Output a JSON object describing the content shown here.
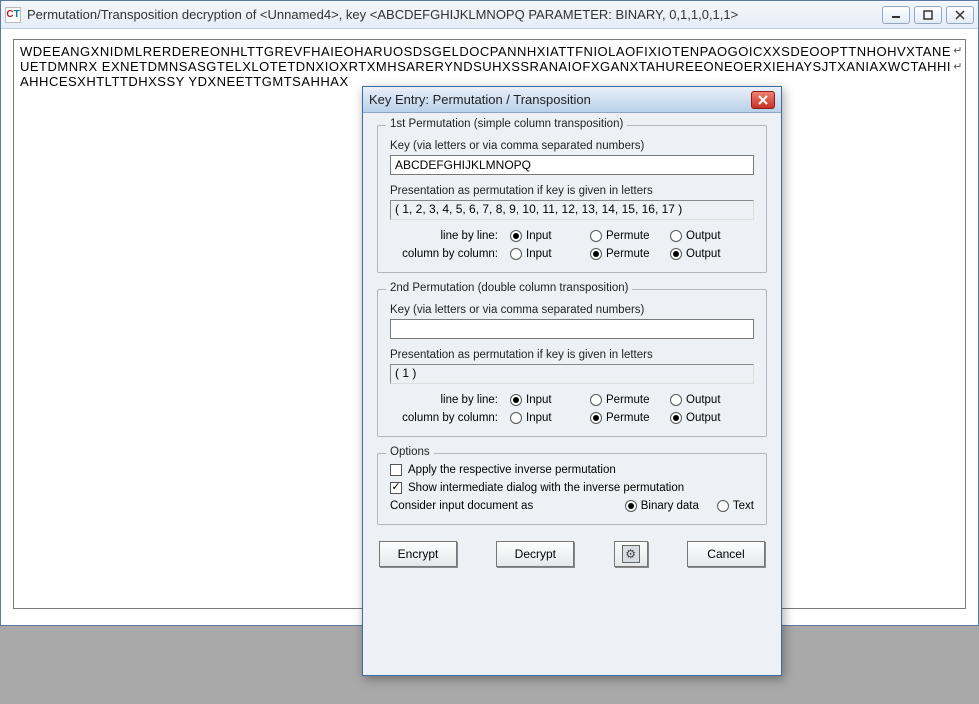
{
  "window": {
    "title": "Permutation/Transposition decryption of <Unnamed4>, key <ABCDEFGHIJKLMNOPQ PARAMETER: BINARY, 0,1,1,0,1,1>",
    "ciphertext": "WDEEANGXNIDMLRERDEREONHLTTGREVFHAIEOHARUOSDSGELDOCPANNHXIATTFNIOLAOFIXIOTENPAOGOICXXSDEOOPTTNHOHVXTANEUETDMNRX EXNETDMNSASGTELXLOTETDNXIOXRTXMHSARERYNDSUHXSSRANAIOFXGANXTAHUREEONEOERXIEHAYSJTXANIAXWCTAHHIAHHCESXHTLTTDHXSSY YDXNEETTGMTSAHHAX"
  },
  "dialog": {
    "title": "Key Entry: Permutation / Transposition",
    "perm1": {
      "group": "1st Permutation (simple column transposition)",
      "key_label": "Key (via letters or via comma separated numbers)",
      "key_value": "ABCDEFGHIJKLMNOPQ",
      "pres_label": "Presentation as permutation if key is given in letters",
      "pres_value": "( 1, 2, 3, 4, 5, 6, 7, 8, 9, 10, 11, 12, 13, 14, 15, 16, 17 )",
      "radio": {
        "row1": "line by line:",
        "row2": "column by column:",
        "c1": "Input",
        "c2": "Permute",
        "c3": "Output"
      }
    },
    "perm2": {
      "group": "2nd Permutation (double column transposition)",
      "key_label": "Key (via letters or via comma separated numbers)",
      "key_value": "",
      "pres_label": "Presentation as permutation if key is given in letters",
      "pres_value": "( 1 )",
      "radio": {
        "row1": "line by line:",
        "row2": "column by column:",
        "c1": "Input",
        "c2": "Permute",
        "c3": "Output"
      }
    },
    "options": {
      "group": "Options",
      "opt1": "Apply the respective inverse permutation",
      "opt2": "Show intermediate dialog with the inverse permutation",
      "consider": "Consider input document as",
      "binary": "Binary data",
      "text": "Text"
    },
    "buttons": {
      "encrypt": "Encrypt",
      "decrypt": "Decrypt",
      "cancel": "Cancel"
    }
  }
}
